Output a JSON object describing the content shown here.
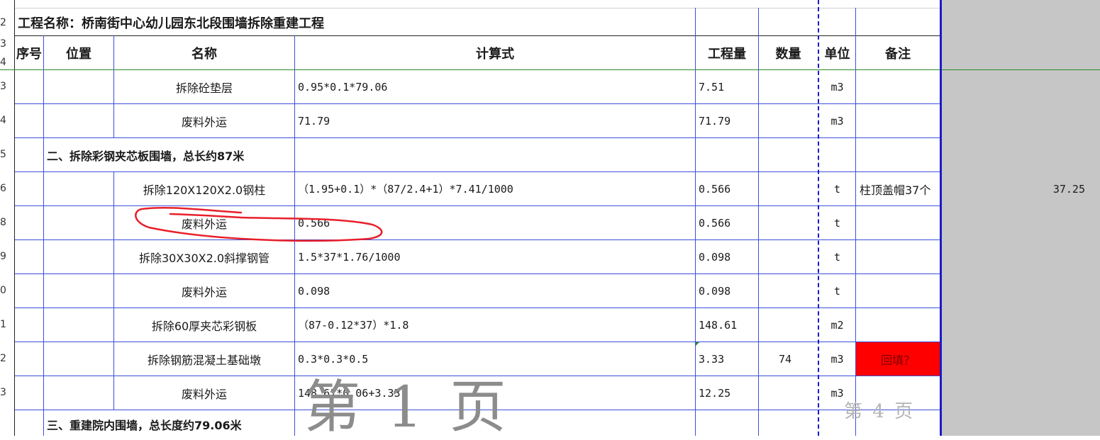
{
  "project_title": "工程名称：桥南街中心幼儿园东北段围墙拆除重建工程",
  "columns": {
    "seq": "序号",
    "position": "位置",
    "name": "名称",
    "formula": "计算式",
    "quantity": "工程量",
    "count": "数量",
    "unit": "单位",
    "remark": "备注"
  },
  "header_row_numbers": [
    "2",
    "3",
    "4"
  ],
  "rows": [
    {
      "rownum": "3",
      "name": "拆除砼垫层",
      "formula": "0.95*0.1*79.06",
      "quantity": "7.51",
      "count": "",
      "unit": "m3",
      "remark": ""
    },
    {
      "rownum": "4",
      "name": "废料外运",
      "formula": "71.79",
      "quantity": "71.79",
      "count": "",
      "unit": "m3",
      "remark": ""
    },
    {
      "rownum": "5",
      "section": "二、拆除彩钢夹芯板围墙，总长约87米"
    },
    {
      "rownum": "6",
      "name": "拆除120X120X2.0钢柱",
      "formula": "（1.95+0.1）*（87/2.4+1）*7.41/1000",
      "quantity": "0.566",
      "count": "",
      "unit": "t",
      "remark": "柱顶盖帽37个",
      "extra": "37.25"
    },
    {
      "rownum": "8",
      "name": "废料外运",
      "formula": "0.566",
      "quantity": "0.566",
      "count": "",
      "unit": "t",
      "remark": ""
    },
    {
      "rownum": "9",
      "name": "拆除30X30X2.0斜撑钢管",
      "formula": "1.5*37*1.76/1000",
      "quantity": "0.098",
      "count": "",
      "unit": "t",
      "remark": ""
    },
    {
      "rownum": "0",
      "name": "废料外运",
      "formula": "0.098",
      "quantity": "0.098",
      "count": "",
      "unit": "t",
      "remark": ""
    },
    {
      "rownum": "1",
      "name": "拆除60厚夹芯彩钢板",
      "formula": "（87-0.12*37）*1.8",
      "quantity": "148.61",
      "count": "",
      "unit": "m2",
      "remark": ""
    },
    {
      "rownum": "2",
      "name": "拆除钢筋混凝土基础墩",
      "formula": "0.3*0.3*0.5",
      "quantity": "3.33",
      "count": "74",
      "unit": "m3",
      "remark": "回填？"
    },
    {
      "rownum": "3",
      "name": "废料外运",
      "formula": "148.61*0.06+3.33",
      "quantity": "12.25",
      "count": "",
      "unit": "m3",
      "remark": ""
    },
    {
      "rownum": "",
      "section": "三、重建院内围墙，总长度约79.06米"
    }
  ],
  "watermarks": {
    "page1": "第 1 页",
    "page4": "第 4 页"
  },
  "colors": {
    "grid": "#3b4fdc",
    "page_border": "#1c1cc8",
    "highlight": "#ff0000",
    "gray_area": "#c6c6c6",
    "annotation_circle": "#e8202a"
  }
}
